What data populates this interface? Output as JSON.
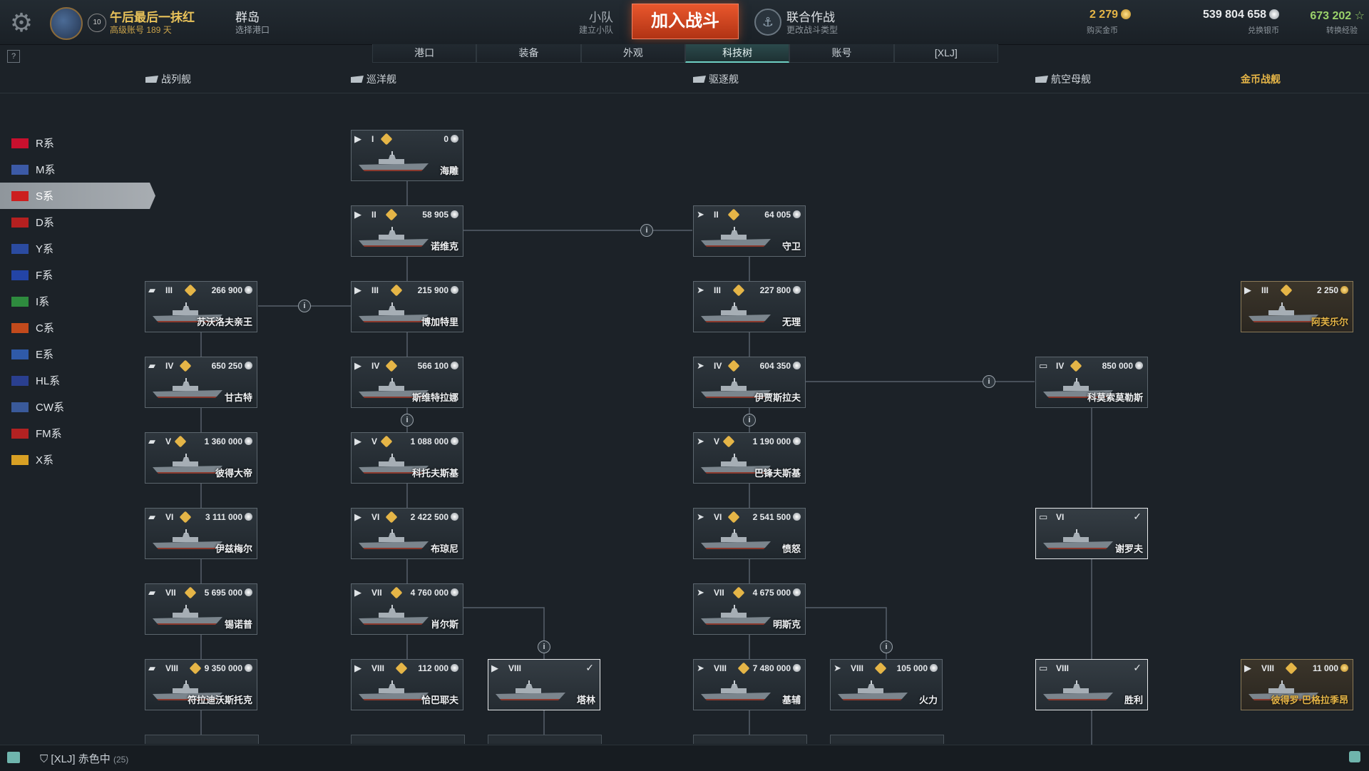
{
  "header": {
    "player_name": "午后最后一抹红",
    "account_info": "高级账号 189 天",
    "level_badge": "10",
    "port_name": "群岛",
    "port_sub": "选择港口",
    "division_label": "小队",
    "division_sub": "建立小队",
    "battle_button": "加入战斗",
    "mode_label": "联合作战",
    "mode_sub": "更改战斗类型",
    "gold_value": "2 279",
    "gold_sub": "购买金币",
    "silver_value": "539 804 658",
    "silver_sub": "兑换银币",
    "xp_value": "673 202",
    "xp_sub": "转换经验"
  },
  "tabs": [
    "港口",
    "装备",
    "外观",
    "科技树",
    "账号",
    "[XLJ]"
  ],
  "active_tab": "科技树",
  "help_label": "?",
  "ship_classes": {
    "battleship": "战列舰",
    "cruiser": "巡洋舰",
    "destroyer": "驱逐舰",
    "carrier": "航空母舰",
    "premium": "金币战舰"
  },
  "nations": [
    {
      "label": "R系",
      "flag_color": "#c8102e"
    },
    {
      "label": "M系",
      "flag_color": "#3c5aa6"
    },
    {
      "label": "S系",
      "flag_color": "#cc1f1f"
    },
    {
      "label": "D系",
      "flag_color": "#b52020"
    },
    {
      "label": "Y系",
      "flag_color": "#2b4ba0"
    },
    {
      "label": "F系",
      "flag_color": "#2344a6"
    },
    {
      "label": "I系",
      "flag_color": "#2e8b3e"
    },
    {
      "label": "C系",
      "flag_color": "#c24a1c"
    },
    {
      "label": "E系",
      "flag_color": "#2f5aa8"
    },
    {
      "label": "HL系",
      "flag_color": "#2a3f8f"
    },
    {
      "label": "CW系",
      "flag_color": "#3a5a9a"
    },
    {
      "label": "FM系",
      "flag_color": "#b22222"
    },
    {
      "label": "X系",
      "flag_color": "#d8a024"
    }
  ],
  "active_nation": "S系",
  "ships": {
    "cl1": {
      "tier": "I",
      "cost": "0",
      "name": "海雕",
      "cls": "cruiser"
    },
    "cl2": {
      "tier": "II",
      "cost": "58 905",
      "name": "诺维克",
      "cls": "cruiser"
    },
    "cl3": {
      "tier": "III",
      "cost": "215 900",
      "name": "博加特里",
      "cls": "cruiser"
    },
    "cl4": {
      "tier": "IV",
      "cost": "566 100",
      "name": "斯维特拉娜",
      "cls": "cruiser"
    },
    "cl5": {
      "tier": "V",
      "cost": "1 088 000",
      "name": "科托夫斯基",
      "cls": "cruiser"
    },
    "cl6": {
      "tier": "VI",
      "cost": "2 422 500",
      "name": "布琼尼",
      "cls": "cruiser"
    },
    "cl7": {
      "tier": "VII",
      "cost": "4 760 000",
      "name": "肖尔斯",
      "cls": "cruiser"
    },
    "cl8": {
      "tier": "VIII",
      "cost": "112 000",
      "name": "恰巴耶夫",
      "cls": "cruiser"
    },
    "cl8b": {
      "tier": "VIII",
      "name": "塔林",
      "cls": "cruiser"
    },
    "bb3": {
      "tier": "III",
      "cost": "266 900",
      "name": "苏沃洛夫亲王",
      "cls": "battleship"
    },
    "bb4": {
      "tier": "IV",
      "cost": "650 250",
      "name": "甘古特",
      "cls": "battleship"
    },
    "bb5": {
      "tier": "V",
      "cost": "1 360 000",
      "name": "彼得大帝",
      "cls": "battleship"
    },
    "bb6": {
      "tier": "VI",
      "cost": "3 111 000",
      "name": "伊兹梅尔",
      "cls": "battleship"
    },
    "bb7": {
      "tier": "VII",
      "cost": "5 695 000",
      "name": "锡诺普",
      "cls": "battleship"
    },
    "bb8": {
      "tier": "VIII",
      "cost": "9 350 000",
      "name": "符拉迪沃斯托克",
      "cls": "battleship"
    },
    "dd2": {
      "tier": "II",
      "cost": "64 005",
      "name": "守卫",
      "cls": "destroyer"
    },
    "dd3": {
      "tier": "III",
      "cost": "227 800",
      "name": "无理",
      "cls": "destroyer"
    },
    "dd4": {
      "tier": "IV",
      "cost": "604 350",
      "name": "伊贾斯拉夫",
      "cls": "destroyer"
    },
    "dd5": {
      "tier": "V",
      "cost": "1 190 000",
      "name": "巴锋夫斯基",
      "cls": "destroyer"
    },
    "dd6": {
      "tier": "VI",
      "cost": "2 541 500",
      "name": "愤怒",
      "cls": "destroyer"
    },
    "dd7": {
      "tier": "VII",
      "cost": "4 675 000",
      "name": "明斯克",
      "cls": "destroyer"
    },
    "dd8": {
      "tier": "VIII",
      "cost": "7 480 000",
      "name": "基辅",
      "cls": "destroyer"
    },
    "dd8b": {
      "tier": "VIII",
      "cost": "105 000",
      "name": "火力",
      "cls": "destroyer"
    },
    "cv4": {
      "tier": "IV",
      "cost": "850 000",
      "name": "科莫索莫勒斯",
      "cls": "carrier"
    },
    "cv6": {
      "tier": "VI",
      "name": "谢罗夫",
      "cls": "carrier"
    },
    "cv8": {
      "tier": "VIII",
      "name": "胜利",
      "cls": "carrier"
    },
    "pr3": {
      "tier": "III",
      "cost": "2 250",
      "name": "阿芙乐尔",
      "cls": "cruiser"
    },
    "pr8": {
      "tier": "VIII",
      "cost": "11 000",
      "name": "彼得罗·巴格拉季昂",
      "cls": "cruiser"
    }
  },
  "info_dot_label": "i",
  "status": {
    "clan_status": "[XLJ]  赤色中",
    "count": "(25)"
  },
  "colors": {
    "accent": "#e9572d",
    "gold": "#e5b547",
    "xp": "#9bd26a",
    "tab_active": "#6fd0c4"
  }
}
